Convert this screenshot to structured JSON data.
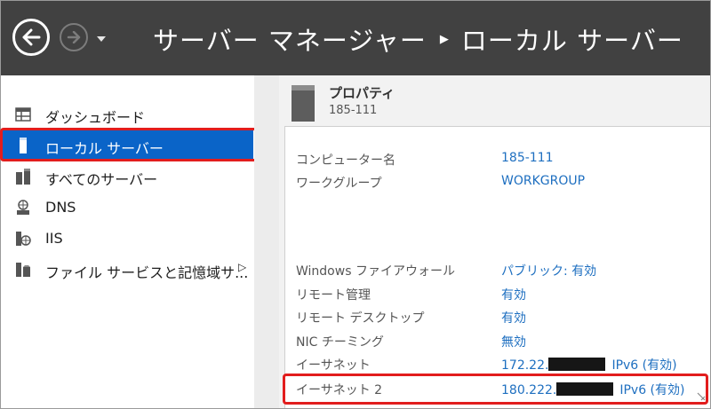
{
  "header": {
    "app": "サーバー マネージャー",
    "page": "ローカル サーバー",
    "back_icon": "back-arrow-icon",
    "forward_icon": "forward-arrow-icon",
    "dropdown_icon": "dropdown-caret-icon"
  },
  "sidebar": {
    "items": [
      {
        "label": "ダッシュボード",
        "icon": "dashboard-icon"
      },
      {
        "label": "ローカル サーバー",
        "icon": "server-icon",
        "selected": true
      },
      {
        "label": "すべてのサーバー",
        "icon": "servers-icon"
      },
      {
        "label": "DNS",
        "icon": "dns-icon"
      },
      {
        "label": "IIS",
        "icon": "iis-icon"
      },
      {
        "label": "ファイル サービスと記憶域サ...",
        "icon": "file-services-icon",
        "expandable": true
      }
    ]
  },
  "properties": {
    "title": "プロパティ",
    "subtitle": "185-111",
    "rows": [
      {
        "key": "コンピューター名",
        "value": "185-111"
      },
      {
        "key": "ワークグループ",
        "value": "WORKGROUP"
      },
      {
        "key": "Windows ファイアウォール",
        "value": "パブリック: 有効"
      },
      {
        "key": "リモート管理",
        "value": "有効"
      },
      {
        "key": "リモート デスクトップ",
        "value": "有効"
      },
      {
        "key": "NIC チーミング",
        "value": "無効"
      },
      {
        "key": "イーサネット",
        "value_prefix": "172.22.",
        "value_suffix": "IPv6 (有効)"
      },
      {
        "key": "イーサネット 2",
        "value_prefix": "180.222.",
        "value_suffix": "IPv6 (有効)"
      }
    ]
  },
  "colors": {
    "titlebar": "#414141",
    "selected": "#0a64c8",
    "highlight": "#e21d1d",
    "link": "#1e6fc0"
  }
}
